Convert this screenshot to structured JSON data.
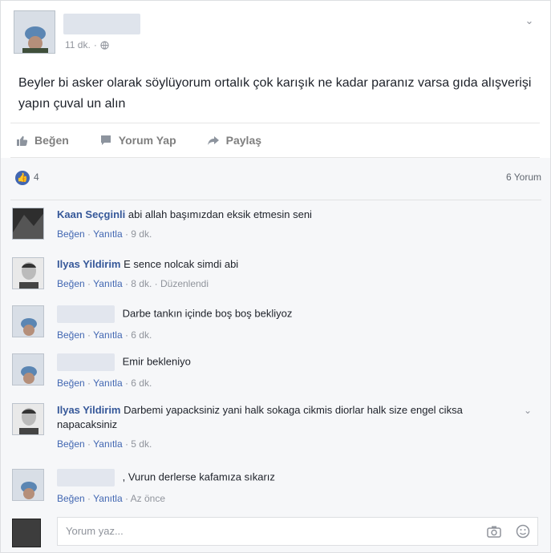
{
  "post": {
    "time": "11 dk.",
    "privacy_icon": "globe-icon",
    "text": "Beyler bi asker olarak söylüyorum ortalık çok karışık ne kadar paranız varsa gıda alışverişi yapın çuval un alın"
  },
  "actions": {
    "like": "Beğen",
    "comment": "Yorum Yap",
    "share": "Paylaş"
  },
  "reactions": {
    "like_count": "4",
    "comment_count": "6 Yorum"
  },
  "comments": [
    {
      "name": "Kaan Seçginli",
      "text": "abi allah başımızdan eksik etmesin seni",
      "like": "Beğen",
      "reply": "Yanıtla",
      "time": "9 dk.",
      "extra": ""
    },
    {
      "name": "Ilyas Yildirim",
      "text": "E sence nolcak simdi abi",
      "like": "Beğen",
      "reply": "Yanıtla",
      "time": "8 dk.",
      "extra": "Düzenlendi"
    },
    {
      "name": "",
      "text": "Darbe tankın içinde boş boş bekliyoz",
      "like": "Beğen",
      "reply": "Yanıtla",
      "time": "6 dk.",
      "extra": ""
    },
    {
      "name": "",
      "text": "Emir bekleniyo",
      "like": "Beğen",
      "reply": "Yanıtla",
      "time": "6 dk.",
      "extra": ""
    },
    {
      "name": "Ilyas Yildirim",
      "text": "Darbemi yapacksiniz yani halk sokaga cikmis diorlar halk size engel ciksa napacaksiniz",
      "like": "Beğen",
      "reply": "Yanıtla",
      "time": "5 dk.",
      "extra": ""
    },
    {
      "name": "",
      "text": ", Vurun derlerse kafamıza sıkarız",
      "like": "Beğen",
      "reply": "Yanıtla",
      "time": "Az önce",
      "extra": ""
    }
  ],
  "compose": {
    "placeholder": "Yorum yaz..."
  }
}
